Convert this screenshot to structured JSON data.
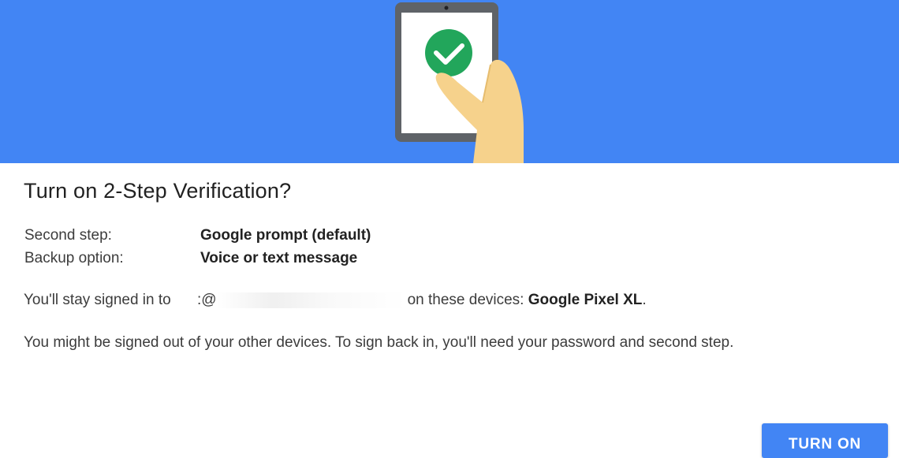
{
  "hero": {
    "icon": "phone-hand-checkmark-icon",
    "background": "#4285f4"
  },
  "dialog": {
    "title": "Turn on 2-Step Verification?",
    "rows": [
      {
        "label": "Second step:",
        "value": "Google prompt (default)"
      },
      {
        "label": "Backup option:",
        "value": "Voice or text message"
      }
    ],
    "signed_in_prefix": "You'll stay signed in to",
    "email_fragment": ":@",
    "signed_in_suffix": "on these devices:",
    "device_name": "Google Pixel XL",
    "device_end": ".",
    "note": "You might be signed out of your other devices. To sign back in, you'll need your password and second step.",
    "turn_on_label": "TURN ON"
  },
  "colors": {
    "accent": "#4285f4",
    "check": "#22a65b",
    "skin": "#f6d28c"
  }
}
